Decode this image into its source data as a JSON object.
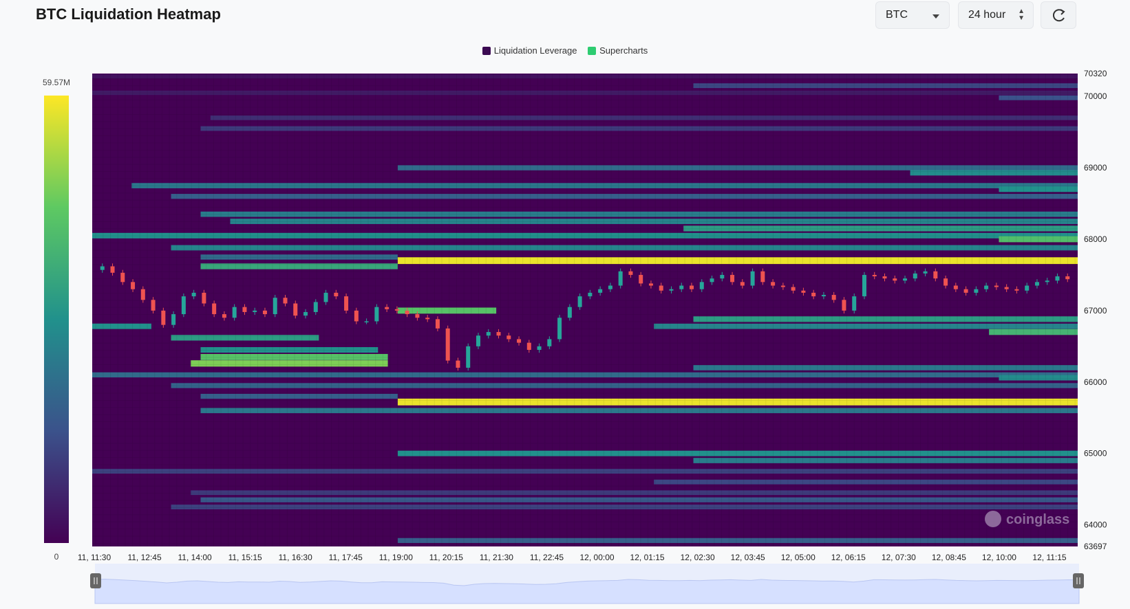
{
  "header": {
    "title": "BTC Liquidation Heatmap"
  },
  "controls": {
    "symbol": "BTC",
    "range": "24 hour",
    "refresh_icon": "refresh-icon"
  },
  "legend": [
    {
      "label": "Liquidation Leverage",
      "color": "#3b0a52"
    },
    {
      "label": "Supercharts",
      "color": "#2ecc71"
    }
  ],
  "colors": {
    "heat_low": "#440154",
    "heat_mid": "#21918c",
    "heat_high": "#fde725",
    "up": "#26a69a",
    "down": "#ef5350",
    "navigator": "#d6e0ff"
  },
  "chart_data": {
    "type": "heatmap",
    "title": "BTC Liquidation Heatmap",
    "colorbar": {
      "min_label": "0",
      "max_label": "59.57M",
      "min": 0,
      "max": 59.57
    },
    "y_range": [
      63697,
      70320
    ],
    "y_ticks": [
      "70320",
      "70000",
      "69000",
      "68000",
      "67000",
      "66000",
      "65000",
      "64000",
      "63697"
    ],
    "x_ticks": [
      "11, 11:30",
      "11, 12:45",
      "11, 14:00",
      "11, 15:15",
      "11, 16:30",
      "11, 17:45",
      "11, 19:00",
      "11, 20:15",
      "11, 21:30",
      "11, 22:45",
      "12, 00:00",
      "12, 01:15",
      "12, 02:30",
      "12, 03:45",
      "12, 05:00",
      "12, 06:15",
      "12, 07:30",
      "12, 08:45",
      "12, 10:00",
      "12, 11:15"
    ],
    "heat_bands": [
      {
        "price": 70280,
        "x_start": 0.0,
        "x_end": 1.0,
        "level": 0.05
      },
      {
        "price": 70150,
        "x_start": 0.61,
        "x_end": 1.0,
        "level": 0.22
      },
      {
        "price": 70050,
        "x_start": 0.0,
        "x_end": 1.0,
        "level": 0.08
      },
      {
        "price": 69980,
        "x_start": 0.92,
        "x_end": 1.0,
        "level": 0.25
      },
      {
        "price": 69700,
        "x_start": 0.12,
        "x_end": 1.0,
        "level": 0.14
      },
      {
        "price": 69550,
        "x_start": 0.11,
        "x_end": 1.0,
        "level": 0.18
      },
      {
        "price": 69000,
        "x_start": 0.31,
        "x_end": 1.0,
        "level": 0.35
      },
      {
        "price": 68930,
        "x_start": 0.83,
        "x_end": 1.0,
        "level": 0.48
      },
      {
        "price": 68750,
        "x_start": 0.04,
        "x_end": 1.0,
        "level": 0.4
      },
      {
        "price": 68700,
        "x_start": 0.92,
        "x_end": 1.0,
        "level": 0.5
      },
      {
        "price": 68600,
        "x_start": 0.08,
        "x_end": 1.0,
        "level": 0.3
      },
      {
        "price": 68350,
        "x_start": 0.11,
        "x_end": 1.0,
        "level": 0.42
      },
      {
        "price": 68250,
        "x_start": 0.14,
        "x_end": 1.0,
        "level": 0.45
      },
      {
        "price": 68150,
        "x_start": 0.6,
        "x_end": 1.0,
        "level": 0.55
      },
      {
        "price": 68050,
        "x_start": 0.0,
        "x_end": 1.0,
        "level": 0.5
      },
      {
        "price": 68000,
        "x_start": 0.92,
        "x_end": 1.0,
        "level": 0.7
      },
      {
        "price": 67880,
        "x_start": 0.08,
        "x_end": 1.0,
        "level": 0.45
      },
      {
        "price": 67750,
        "x_start": 0.11,
        "x_end": 0.31,
        "level": 0.35
      },
      {
        "price": 67700,
        "x_start": 0.31,
        "x_end": 1.0,
        "level": 0.97
      },
      {
        "price": 67620,
        "x_start": 0.11,
        "x_end": 0.31,
        "level": 0.6
      },
      {
        "price": 67000,
        "x_start": 0.31,
        "x_end": 0.41,
        "level": 0.72
      },
      {
        "price": 66880,
        "x_start": 0.61,
        "x_end": 1.0,
        "level": 0.55
      },
      {
        "price": 66780,
        "x_start": 0.0,
        "x_end": 0.06,
        "level": 0.5
      },
      {
        "price": 66780,
        "x_start": 0.57,
        "x_end": 1.0,
        "level": 0.45
      },
      {
        "price": 66700,
        "x_start": 0.91,
        "x_end": 1.0,
        "level": 0.65
      },
      {
        "price": 66620,
        "x_start": 0.08,
        "x_end": 0.23,
        "level": 0.55
      },
      {
        "price": 66450,
        "x_start": 0.11,
        "x_end": 0.29,
        "level": 0.5
      },
      {
        "price": 66350,
        "x_start": 0.11,
        "x_end": 0.3,
        "level": 0.72
      },
      {
        "price": 66260,
        "x_start": 0.1,
        "x_end": 0.3,
        "level": 0.8
      },
      {
        "price": 66200,
        "x_start": 0.61,
        "x_end": 1.0,
        "level": 0.4
      },
      {
        "price": 66100,
        "x_start": 0.0,
        "x_end": 1.0,
        "level": 0.35
      },
      {
        "price": 66060,
        "x_start": 0.92,
        "x_end": 1.0,
        "level": 0.48
      },
      {
        "price": 65950,
        "x_start": 0.08,
        "x_end": 1.0,
        "level": 0.32
      },
      {
        "price": 65800,
        "x_start": 0.11,
        "x_end": 0.31,
        "level": 0.3
      },
      {
        "price": 65720,
        "x_start": 0.31,
        "x_end": 1.0,
        "level": 0.97
      },
      {
        "price": 65600,
        "x_start": 0.11,
        "x_end": 1.0,
        "level": 0.4
      },
      {
        "price": 65000,
        "x_start": 0.31,
        "x_end": 1.0,
        "level": 0.5
      },
      {
        "price": 64900,
        "x_start": 0.61,
        "x_end": 1.0,
        "level": 0.42
      },
      {
        "price": 64750,
        "x_start": 0.0,
        "x_end": 1.0,
        "level": 0.2
      },
      {
        "price": 64600,
        "x_start": 0.57,
        "x_end": 1.0,
        "level": 0.22
      },
      {
        "price": 64450,
        "x_start": 0.1,
        "x_end": 1.0,
        "level": 0.18
      },
      {
        "price": 64350,
        "x_start": 0.11,
        "x_end": 1.0,
        "level": 0.28
      },
      {
        "price": 64250,
        "x_start": 0.08,
        "x_end": 1.0,
        "level": 0.2
      },
      {
        "price": 63780,
        "x_start": 0.31,
        "x_end": 1.0,
        "level": 0.3
      }
    ],
    "price_series": [
      67570,
      67620,
      67530,
      67400,
      67300,
      67150,
      67000,
      66800,
      66950,
      67200,
      67250,
      67100,
      66950,
      66900,
      67050,
      66980,
      67000,
      66950,
      67180,
      67100,
      66930,
      66980,
      67120,
      67250,
      67200,
      67000,
      66850,
      66850,
      67050,
      67020,
      67000,
      66950,
      66900,
      66880,
      66750,
      66300,
      66200,
      66500,
      66650,
      66700,
      66650,
      66600,
      66550,
      66450,
      66500,
      66600,
      66900,
      67050,
      67200,
      67250,
      67300,
      67350,
      67550,
      67500,
      67380,
      67350,
      67280,
      67300,
      67350,
      67300,
      67400,
      67450,
      67500,
      67400,
      67350,
      67550,
      67400,
      67350,
      67330,
      67280,
      67250,
      67200,
      67220,
      67150,
      67000,
      67200,
      67500,
      67480,
      67450,
      67420,
      67450,
      67520,
      67550,
      67450,
      67350,
      67300,
      67250,
      67300,
      67350,
      67330,
      67300,
      67280,
      67350,
      67400,
      67420,
      67480,
      67440
    ],
    "navigator": {
      "range": [
        0,
        1
      ]
    }
  }
}
